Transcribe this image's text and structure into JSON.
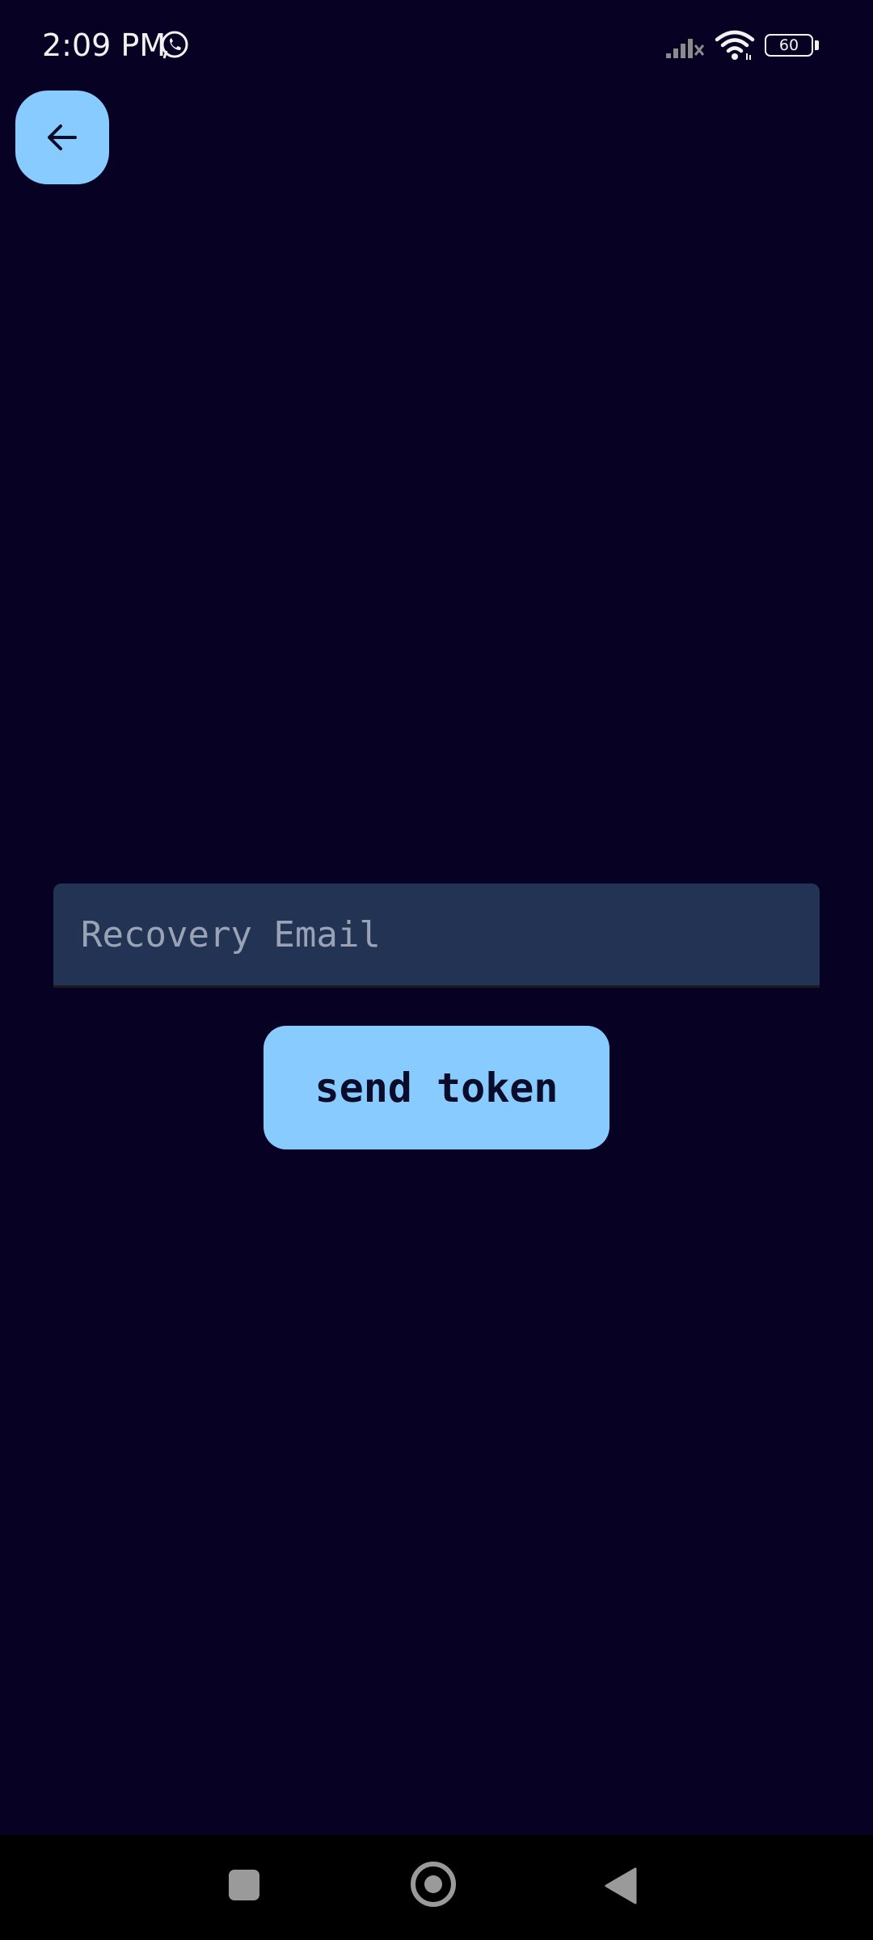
{
  "status_bar": {
    "time": "2:09 PM",
    "battery_level": "60",
    "icons": [
      "whatsapp-icon",
      "signal-icon",
      "wifi-icon",
      "battery-icon"
    ]
  },
  "header": {
    "back_icon": "arrow-left-icon"
  },
  "form": {
    "email_placeholder": "Recovery Email",
    "email_value": "",
    "send_label": "send token"
  },
  "nav_bar": {
    "icons": [
      "recent-apps-icon",
      "home-icon",
      "back-triangle-icon"
    ]
  },
  "colors": {
    "background": "#070223",
    "accent": "#88ccff",
    "field_background": "#233353",
    "nav_background": "#000000"
  }
}
